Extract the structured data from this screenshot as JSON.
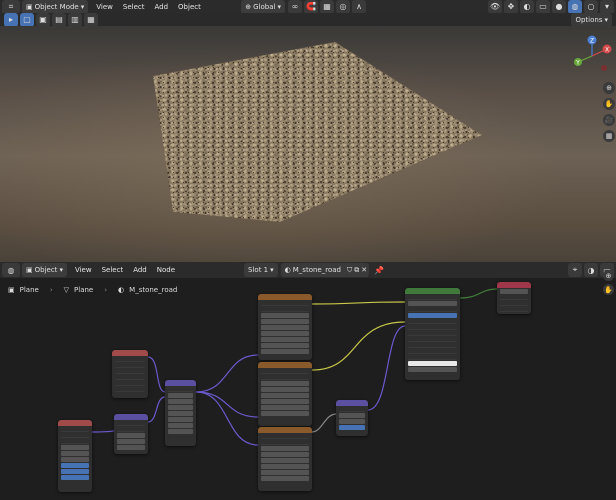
{
  "colors": {
    "node_text": "#2d4f8f",
    "node_image": "#8b5a2b",
    "node_vector": "#5a4fa0",
    "node_shader": "#3f7a3a",
    "node_output": "#a0364a",
    "node_input": "#a04a4a",
    "wire_yellow": "#c8c84a",
    "wire_purple": "#6a5acd",
    "wire_gray": "#8a8a8a"
  },
  "viewport": {
    "mode_label": "Object Mode",
    "menus": [
      "View",
      "Select",
      "Add",
      "Object"
    ],
    "transform_orientation": "Global",
    "options_label": "Options",
    "axes": {
      "x": "X",
      "y": "Y",
      "z": "Z"
    }
  },
  "node_editor": {
    "object_label": "Object",
    "menus": [
      "View",
      "Select",
      "Add",
      "Node"
    ],
    "slot_label": "Slot 1",
    "material_name": "M_stone_road",
    "breadcrumb": [
      {
        "icon": "plane-mesh-icon",
        "label": "Plane"
      },
      {
        "icon": "mesh-data-icon",
        "label": "Plane"
      },
      {
        "icon": "material-icon",
        "label": "M_stone_road"
      }
    ]
  }
}
